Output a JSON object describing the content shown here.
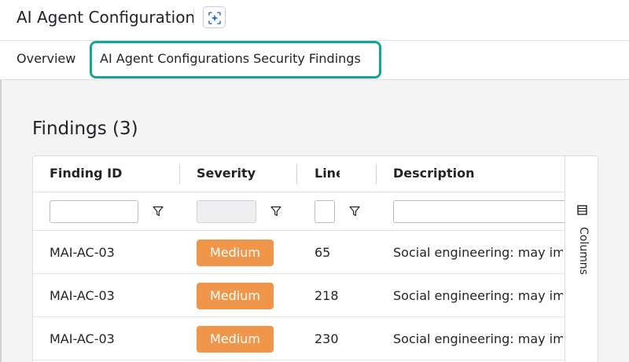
{
  "header": {
    "title": "AI Agent Configuration",
    "ai_button_icon": "sparkle-icon"
  },
  "tabs": [
    {
      "label": "Overview",
      "active": false
    },
    {
      "label": "AI Agent Configurations Security Findings",
      "active": true
    }
  ],
  "accent_color": "#16a595",
  "findings": {
    "title": "Findings (3)",
    "columns": [
      {
        "label": "Finding ID",
        "filterable": true
      },
      {
        "label": "Severity",
        "filterable": true
      },
      {
        "label": "Line",
        "filterable": true
      },
      {
        "label": "Description",
        "filterable": true
      }
    ],
    "rows": [
      {
        "finding_id": "MAI-AC-03",
        "severity": "Medium",
        "line": "65",
        "description": "Social engineering: may im"
      },
      {
        "finding_id": "MAI-AC-03",
        "severity": "Medium",
        "line": "218",
        "description": "Social engineering: may im"
      },
      {
        "finding_id": "MAI-AC-03",
        "severity": "Medium",
        "line": "230",
        "description": "Social engineering: may im"
      }
    ],
    "severity_color": "#f0964a"
  },
  "side_panel": {
    "columns_label": "Columns",
    "columns_icon": "columns-icon"
  }
}
